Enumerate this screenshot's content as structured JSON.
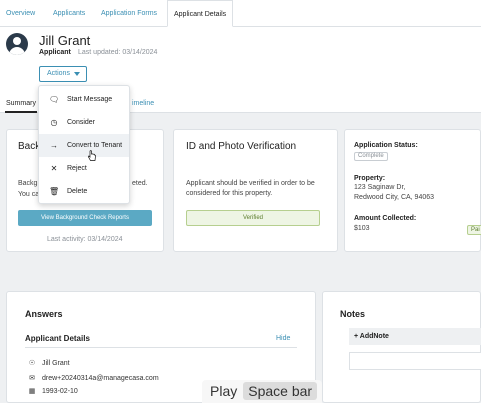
{
  "tabs": [
    {
      "label": "Overview"
    },
    {
      "label": "Applicants"
    },
    {
      "label": "Application Forms"
    },
    {
      "label": "Applicant Details"
    }
  ],
  "header": {
    "name": "Jill Grant",
    "role": "Applicant",
    "last_updated": "Last updated: 03/14/2024",
    "actions_label": "Actions"
  },
  "subtabs": {
    "summary": "Summary",
    "timeline": "imeline"
  },
  "menu": {
    "items": [
      {
        "label": "Start Message",
        "icon": "message-icon"
      },
      {
        "label": "Consider",
        "icon": "clock-icon"
      },
      {
        "label": "Convert to Tenant",
        "icon": "arrow-right-icon"
      },
      {
        "label": "Reject",
        "icon": "x-icon"
      },
      {
        "label": "Delete",
        "icon": "trash-icon"
      }
    ]
  },
  "background_card": {
    "title": "Back",
    "text_line1": "Backgr",
    "text_line1_end": "eted.",
    "text_line2": "You ca",
    "button": "View Background Check Reports",
    "last_activity": "Last activity: 03/14/2024"
  },
  "id_card": {
    "title": "ID and Photo Verification",
    "text": "Applicant should be verified in order to be considered for this property.",
    "button": "Verified"
  },
  "status_card": {
    "status_label": "Application Status:",
    "status_value": "Complete",
    "property_label": "Property:",
    "address_line1": "123 Saginaw Dr,",
    "address_line2": "Redwood City, CA, 94063",
    "amount_label": "Amount Collected:",
    "amount_value": "$103",
    "paid_badge": "Pai"
  },
  "answers": {
    "title": "Answers",
    "subtitle": "Applicant Details",
    "hide": "Hide",
    "name": "Jill Grant",
    "email": "drew+20240314a@managecasa.com",
    "dob": "1993-02-10"
  },
  "notes": {
    "title": "Notes",
    "add_note": "+ AddNote"
  },
  "caption": {
    "play": "Play",
    "key": "Space bar"
  },
  "colors": {
    "link": "#3b8fb3",
    "primary_button": "#5ba9c4",
    "verified_bg": "#eef5e4"
  }
}
